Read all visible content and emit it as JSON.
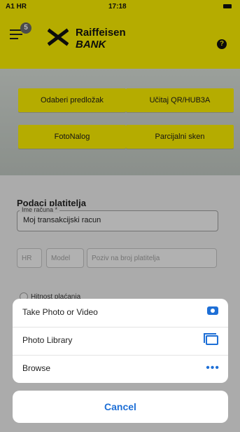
{
  "status": {
    "carrier": "A1 HR",
    "time": "17:18"
  },
  "app": {
    "badge_count": "5",
    "brand_line1": "Raiffeisen",
    "brand_line2": "BANK",
    "help_label": "?"
  },
  "actions": [
    {
      "label": "Odaberi predložak"
    },
    {
      "label": "Učitaj QR/HUB3A"
    },
    {
      "label": "FotoNalog"
    },
    {
      "label": "Parcijalni sken"
    }
  ],
  "form": {
    "section_title": "Podaci platitelja",
    "account_label": "Ime računa *",
    "account_value": "Moj transakcijski racun",
    "hr_prefix": "HR",
    "model_placeholder": "Model",
    "reference_placeholder": "Poziv na broj platitelja",
    "urgency_label": "Hitnost plaćanja"
  },
  "action_sheet": {
    "options": [
      {
        "label": "Take Photo or Video",
        "icon": "camera-icon"
      },
      {
        "label": "Photo Library",
        "icon": "photo-library-icon"
      },
      {
        "label": "Browse",
        "icon": "more-dots-icon"
      }
    ],
    "cancel_label": "Cancel"
  },
  "colors": {
    "brand_yellow": "#f2e600",
    "ios_blue": "#1e6fd6"
  }
}
